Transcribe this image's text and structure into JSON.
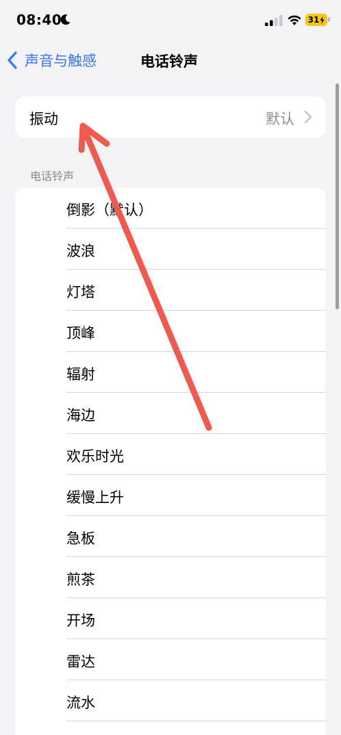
{
  "status_bar": {
    "time": "08:40",
    "battery_level": "31",
    "icons": [
      "moon-icon",
      "signal-icon",
      "wifi-icon",
      "battery-icon"
    ]
  },
  "nav": {
    "back_label": "声音与触感",
    "title": "电话铃声"
  },
  "vibration": {
    "label": "振动",
    "value": "默认"
  },
  "section_header": "电话铃声",
  "ringtones": [
    {
      "label": "倒影（默认）"
    },
    {
      "label": "波浪"
    },
    {
      "label": "灯塔"
    },
    {
      "label": "顶峰"
    },
    {
      "label": "辐射"
    },
    {
      "label": "海边"
    },
    {
      "label": "欢乐时光"
    },
    {
      "label": "缓慢上升"
    },
    {
      "label": "急板"
    },
    {
      "label": "煎茶"
    },
    {
      "label": "开场"
    },
    {
      "label": "雷达"
    },
    {
      "label": "流水"
    }
  ],
  "colors": {
    "accent": "#3478f6",
    "background": "#f2f2f7",
    "annotation_arrow": "#ef5a4c",
    "battery": "#f5c518"
  }
}
